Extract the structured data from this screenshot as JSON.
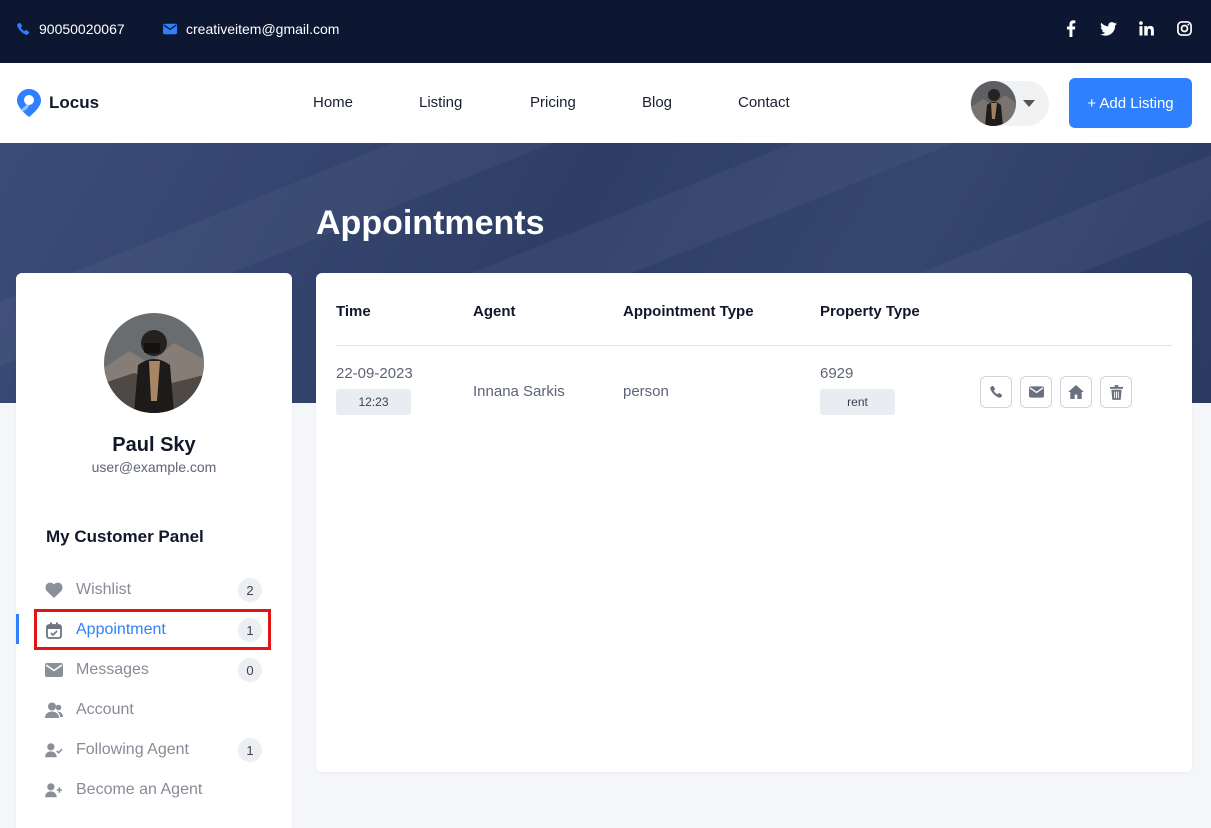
{
  "topbar": {
    "phone": "90050020067",
    "email": "creativeitem@gmail.com",
    "social": [
      "facebook-icon",
      "twitter-icon",
      "linkedin-icon",
      "instagram-icon"
    ]
  },
  "nav": {
    "brand": "Locus",
    "links": [
      "Home",
      "Listing",
      "Pricing",
      "Blog",
      "Contact"
    ],
    "add_listing": "+ Add Listing"
  },
  "hero": {
    "title": "Appointments"
  },
  "profile": {
    "name": "Paul Sky",
    "email": "user@example.com",
    "panel_title": "My Customer Panel"
  },
  "menu": [
    {
      "label": "Wishlist",
      "icon": "heart-icon",
      "count": "2"
    },
    {
      "label": "Appointment",
      "icon": "calendar-check-icon",
      "count": "1",
      "active": true
    },
    {
      "label": "Messages",
      "icon": "envelope-icon",
      "count": "0"
    },
    {
      "label": "Account",
      "icon": "users-icon",
      "count": ""
    },
    {
      "label": "Following Agent",
      "icon": "user-check-icon",
      "count": "1"
    },
    {
      "label": "Become an Agent",
      "icon": "user-plus-icon",
      "count": ""
    }
  ],
  "table": {
    "headers": [
      "Time",
      "Agent",
      "Appointment Type",
      "Property Type"
    ],
    "rows": [
      {
        "date": "22-09-2023",
        "time": "12:23",
        "agent": "Innana Sarkis",
        "appointment_type": "person",
        "property_id": "6929",
        "property_type": "rent",
        "actions": [
          "phone-icon",
          "envelope-icon",
          "home-icon",
          "trash-icon"
        ]
      }
    ]
  },
  "colors": {
    "topbar": "#0d1732",
    "accent": "#2f80ff",
    "hero": "#33446e",
    "highlight": "#e21515"
  }
}
